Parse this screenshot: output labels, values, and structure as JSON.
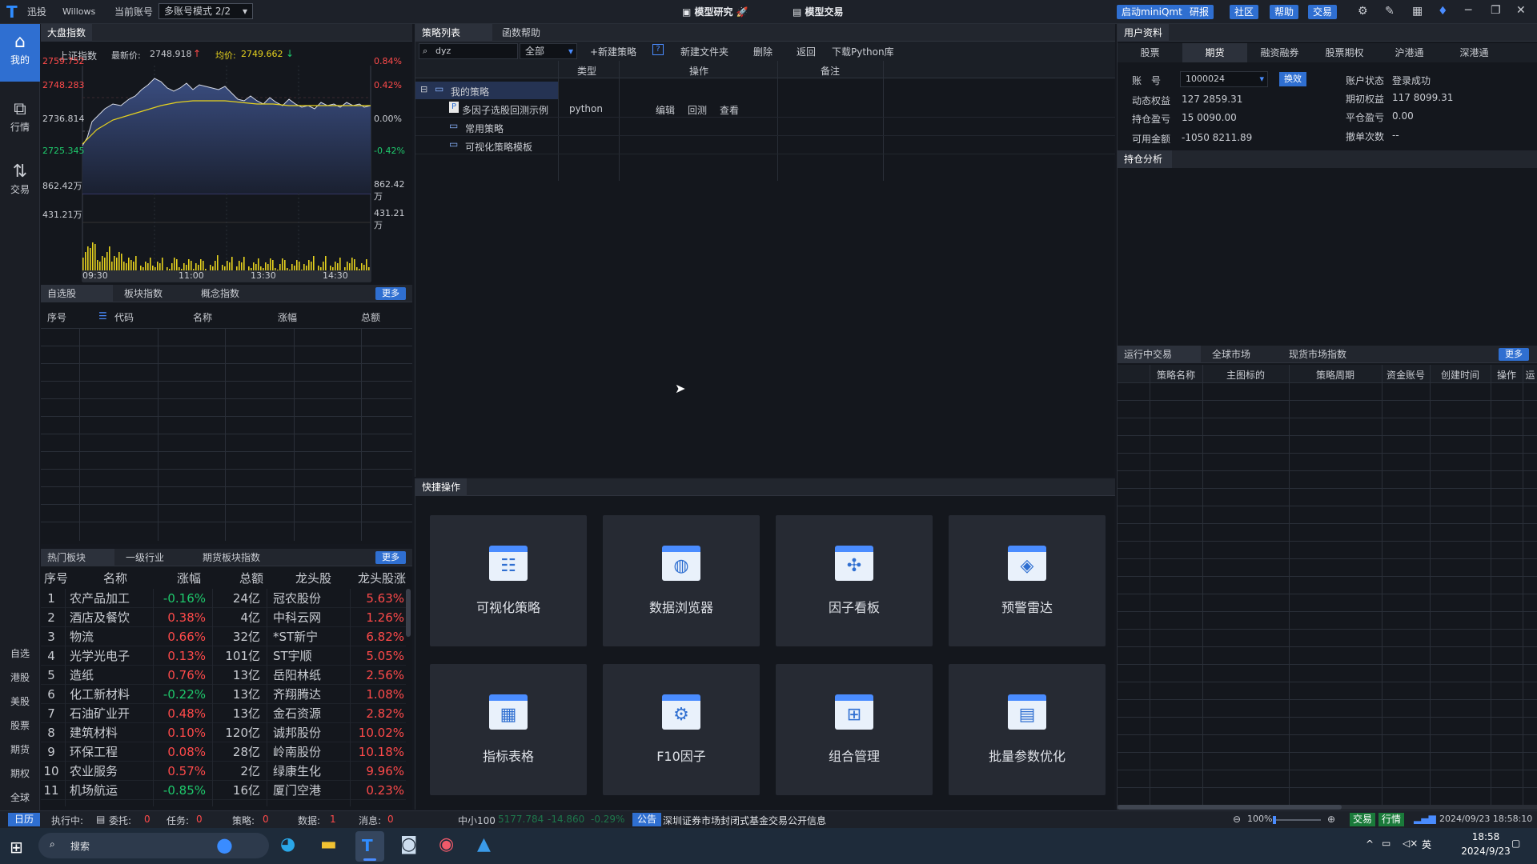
{
  "titlebar": {
    "app_name": "迅投",
    "user": "Willows",
    "account_label": "当前账号",
    "account_mode": "多账号模式 2/2",
    "tab_research": "模型研究",
    "tab_trade": "模型交易",
    "buttons": [
      "启动miniQmt",
      "研报",
      "社区",
      "帮助",
      "交易"
    ]
  },
  "leftnav": {
    "items": [
      {
        "label": "我的",
        "icon": "home-icon"
      },
      {
        "label": "行情",
        "icon": "chart-icon"
      },
      {
        "label": "交易",
        "icon": "trade-icon"
      }
    ],
    "small_items": [
      "自选",
      "港股",
      "美股",
      "股票",
      "期货",
      "期权",
      "全球"
    ]
  },
  "index_panel": {
    "tab": "大盘指数",
    "name": "上证指数",
    "last_label": "最新价:",
    "last_value": "2748.918",
    "avg_label": "均价:",
    "avg_value": "2749.662",
    "y_left": [
      "2759.752",
      "2748.283",
      "2736.814",
      "2725.345",
      "862.42万",
      "431.21万"
    ],
    "y_right": [
      "0.84%",
      "0.42%",
      "0.00%",
      "-0.42%",
      "862.42万",
      "431.21万"
    ],
    "x_labels": [
      "09:30",
      "11:00",
      "13:30",
      "14:30"
    ]
  },
  "watch_panel": {
    "tabs": [
      "自选股",
      "板块指数",
      "概念指数"
    ],
    "more": "更多",
    "columns": [
      "序号",
      "代码",
      "名称",
      "涨幅",
      "总额"
    ]
  },
  "sector_panel": {
    "tabs": [
      "热门板块",
      "一级行业",
      "期货板块指数"
    ],
    "more": "更多",
    "columns": [
      "序号",
      "名称",
      "涨幅",
      "总额",
      "龙头股",
      "龙头股涨"
    ],
    "rows": [
      {
        "no": "1",
        "name": "农产品加工",
        "chg": "-0.16%",
        "amt": "24亿",
        "leader": "冠农股份",
        "lchg": "5.63%"
      },
      {
        "no": "2",
        "name": "酒店及餐饮",
        "chg": "0.38%",
        "amt": "4亿",
        "leader": "中科云网",
        "lchg": "1.26%"
      },
      {
        "no": "3",
        "name": "物流",
        "chg": "0.66%",
        "amt": "32亿",
        "leader": "*ST新宁",
        "lchg": "6.82%"
      },
      {
        "no": "4",
        "name": "光学光电子",
        "chg": "0.13%",
        "amt": "101亿",
        "leader": "ST宇顺",
        "lchg": "5.05%"
      },
      {
        "no": "5",
        "name": "造纸",
        "chg": "0.76%",
        "amt": "13亿",
        "leader": "岳阳林纸",
        "lchg": "2.56%"
      },
      {
        "no": "6",
        "name": "化工新材料",
        "chg": "-0.22%",
        "amt": "13亿",
        "leader": "齐翔腾达",
        "lchg": "1.08%"
      },
      {
        "no": "7",
        "name": "石油矿业开",
        "chg": "0.48%",
        "amt": "13亿",
        "leader": "金石资源",
        "lchg": "2.82%"
      },
      {
        "no": "8",
        "name": "建筑材料",
        "chg": "0.10%",
        "amt": "120亿",
        "leader": "诚邦股份",
        "lchg": "10.02%"
      },
      {
        "no": "9",
        "name": "环保工程",
        "chg": "0.08%",
        "amt": "28亿",
        "leader": "岭南股份",
        "lchg": "10.18%"
      },
      {
        "no": "10",
        "name": "农业服务",
        "chg": "0.57%",
        "amt": "2亿",
        "leader": "绿康生化",
        "lchg": "9.96%"
      },
      {
        "no": "11",
        "name": "机场航运",
        "chg": "-0.85%",
        "amt": "16亿",
        "leader": "厦门空港",
        "lchg": "0.23%"
      }
    ]
  },
  "strategy_panel": {
    "tabs": [
      "策略列表",
      "函数帮助"
    ],
    "search_value": "dyz",
    "filter": "全部",
    "actions": [
      "+新建策略",
      "?",
      "新建文件夹",
      "删除",
      "返回",
      "下载Python库"
    ],
    "columns": [
      "类型",
      "操作",
      "备注"
    ],
    "tree": {
      "root": "我的策略",
      "items": [
        {
          "name": "多因子选股回测示例",
          "type": "python",
          "ops": [
            "编辑",
            "回测",
            "查看"
          ]
        },
        {
          "name": "常用策略"
        },
        {
          "name": "可视化策略模板"
        }
      ]
    }
  },
  "quick_panel": {
    "title": "快捷操作",
    "tiles": [
      {
        "label": "可视化策略",
        "icon": "visual-strategy-icon"
      },
      {
        "label": "数据浏览器",
        "icon": "data-browser-icon"
      },
      {
        "label": "因子看板",
        "icon": "factor-board-icon"
      },
      {
        "label": "预警雷达",
        "icon": "alert-radar-icon"
      },
      {
        "label": "指标表格",
        "icon": "indicator-table-icon"
      },
      {
        "label": "F10因子",
        "icon": "f10-factor-icon"
      },
      {
        "label": "组合管理",
        "icon": "portfolio-icon"
      },
      {
        "label": "批量参数优化",
        "icon": "param-optimize-icon"
      }
    ]
  },
  "user_panel": {
    "title": "用户资料",
    "tabs": [
      "股票",
      "期货",
      "融资融券",
      "股票期权",
      "沪港通",
      "深港通"
    ],
    "account_label": "账　号",
    "account_value": "1000024",
    "switch_btn": "换效",
    "fields": [
      {
        "k": "动态权益",
        "v": "127 2859.31"
      },
      {
        "k": "持仓盈亏",
        "v": "15 0090.00"
      },
      {
        "k": "可用金额",
        "v": "-1050 8211.89"
      }
    ],
    "fields_right": [
      {
        "k": "账户状态",
        "v": "登录成功"
      },
      {
        "k": "期初权益",
        "v": "117 8099.31"
      },
      {
        "k": "平仓盈亏",
        "v": "0.00"
      },
      {
        "k": "撤单次数",
        "v": "--"
      }
    ],
    "analysis_tab": "持仓分析"
  },
  "running_panel": {
    "tabs": [
      "运行中交易",
      "全球市场",
      "现货市场指数"
    ],
    "more": "更多",
    "columns": [
      "策略名称",
      "主图标的",
      "策略周期",
      "资金账号",
      "创建时间",
      "操作",
      "运"
    ]
  },
  "statusbar": {
    "calendar": "日历",
    "executing": "执行中:",
    "entrust_label": "委托:",
    "entrust": "0",
    "task_label": "任务:",
    "task": "0",
    "strategy_label": "策略:",
    "strategy": "0",
    "data_label": "数据:",
    "data": "1",
    "msg_label": "消息:",
    "msg": "0",
    "index_name": "中小100",
    "index_val": "5177.784",
    "index_chg": "-14.860",
    "index_pct": "-0.29%",
    "notice_tag": "公告",
    "notice": "深圳证券市场封闭式基金交易公开信息",
    "zoom": "100%",
    "trade": "交易",
    "quote": "行情",
    "datetime": "2024/09/23 18:58:10"
  },
  "taskbar": {
    "search": "搜索",
    "lang": "英",
    "time": "18:58",
    "date": "2024/9/23"
  }
}
